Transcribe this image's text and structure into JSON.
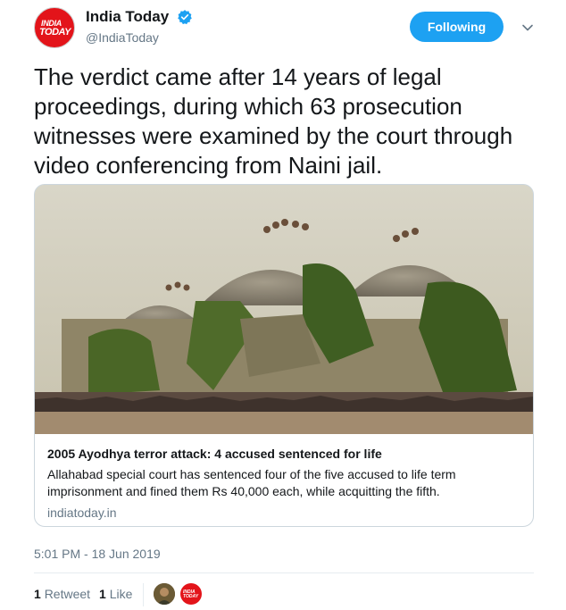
{
  "account": {
    "display_name": "India Today",
    "handle": "@IndiaToday",
    "avatar_text_top": "INDIA",
    "avatar_text_bottom": "TODAY"
  },
  "follow_button": {
    "label": "Following"
  },
  "tweet": {
    "text": "The verdict came after 14 years of legal proceedings, during which 63 prosecution witnesses were examined by the court through video conferencing from Naini jail.",
    "timestamp": "5:01 PM - 18 Jun 2019"
  },
  "card": {
    "title": "2005 Ayodhya terror attack: 4 accused sentenced for life",
    "description": "Allahabad special court has sentenced four of the five accused to life term imprisonment and fined them Rs 40,000 each, while acquitting the fifth.",
    "domain": "indiatoday.in"
  },
  "stats": {
    "retweets_count": "1",
    "retweets_label": "Retweet",
    "likes_count": "1",
    "likes_label": "Like"
  },
  "colors": {
    "accent": "#1da1f2",
    "brand_red": "#e3141a",
    "muted_text": "#657786",
    "border": "#ccd6dd"
  },
  "icons": [
    "verified-badge-icon",
    "chevron-down-icon"
  ]
}
